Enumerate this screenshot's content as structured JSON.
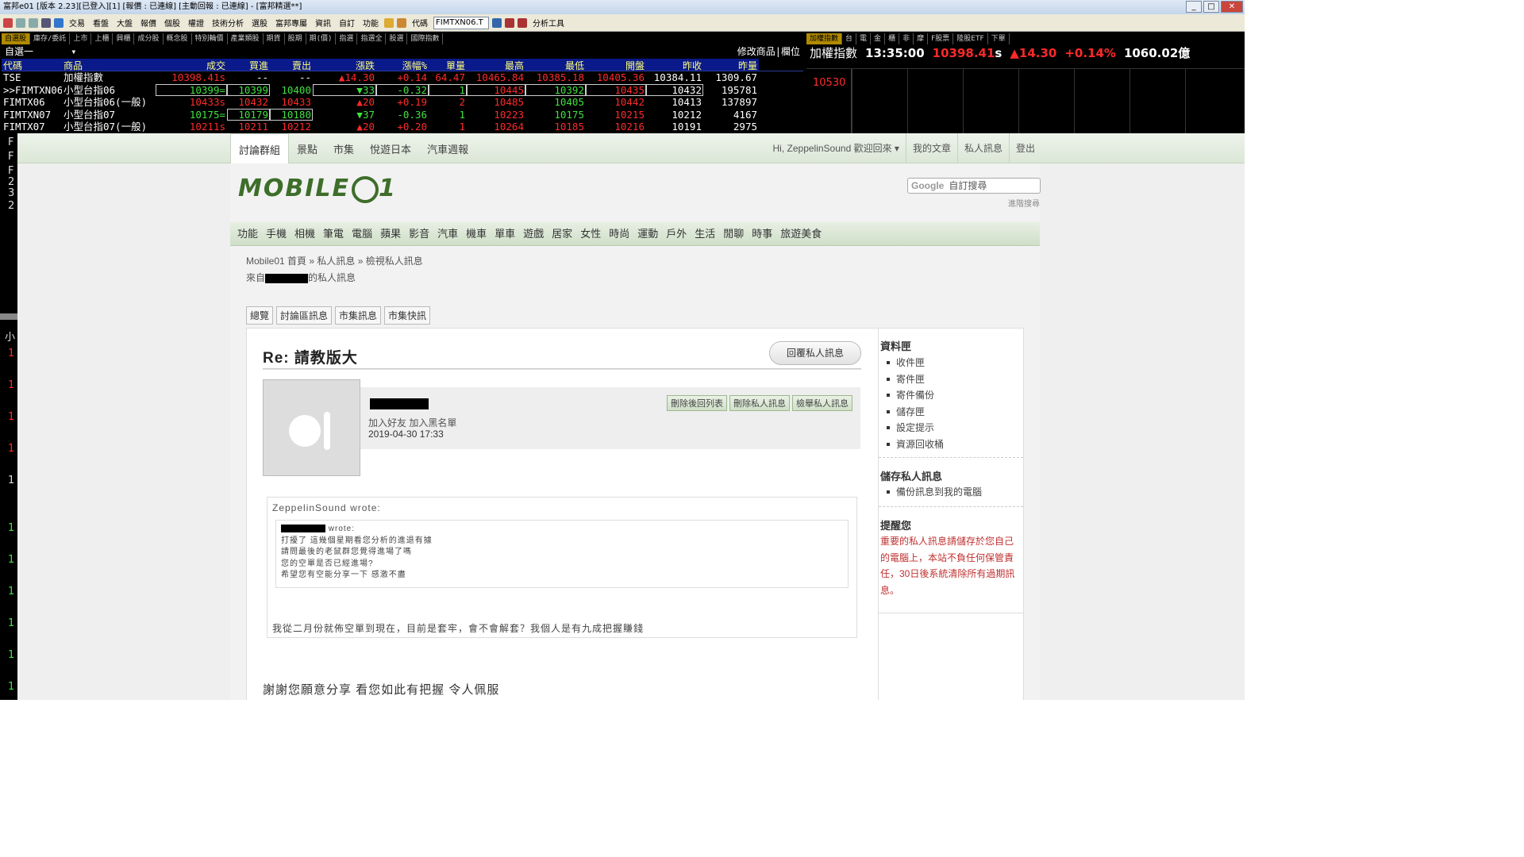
{
  "app": {
    "title": "富邦e01 [版本 2.23][已登入][1] [報價 : 已連線] [主動回報 : 已連線] - [富邦精選**]",
    "win_min": "_",
    "win_max": "□",
    "win_close": "✕",
    "toolbar": [
      "交易",
      "看盤",
      "大盤",
      "報價",
      "個股",
      "權證",
      "技術分析",
      "選股",
      "富邦專屬",
      "資訊",
      "自訂",
      "功能"
    ],
    "code_label": "代碼",
    "code_value": "FIMTXN06.T",
    "analysis_tools": "分析工具"
  },
  "quote": {
    "tabs": [
      "自選股",
      "庫存/委託",
      "上市",
      "上櫃",
      "興櫃",
      "成分股",
      "概念股",
      "特別輪價",
      "產業類股",
      "期貨",
      "股期",
      "期(價)",
      "指選",
      "指選全",
      "股選",
      "國際指數"
    ],
    "selector": "自選一",
    "selector_arrow": "▾",
    "right_links": [
      "修改商品",
      "欄位"
    ],
    "headers": [
      "代碼",
      "商品",
      "成交",
      "買進",
      "賣出",
      "漲跌",
      "漲幅%",
      "單量",
      "最高",
      "最低",
      "開盤",
      "昨收",
      "昨量"
    ],
    "rows": [
      [
        "TSE",
        "加權指數",
        "10398.41s",
        "--",
        "--",
        "▲14.30",
        "+0.14",
        "64.47",
        "10465.84",
        "10385.18",
        "10405.36",
        "10384.11",
        "1309.67"
      ],
      [
        ">>FIMTXN06",
        "小型台指06",
        "10399=",
        "10399",
        "10400",
        "▼33",
        "-0.32",
        "1",
        "10445",
        "10392",
        "10435",
        "10432",
        "195781"
      ],
      [
        "FIMTX06",
        "小型台指06(一般)",
        "10433s",
        "10432",
        "10433",
        "▲20",
        "+0.19",
        "2",
        "10485",
        "10405",
        "10442",
        "10413",
        "137897"
      ],
      [
        "FIMTXN07",
        "小型台指07",
        "10175=",
        "10179",
        "10180",
        "▼37",
        "-0.36",
        "1",
        "10223",
        "10175",
        "10215",
        "10212",
        "4167"
      ],
      [
        "FIMTX07",
        "小型台指07(一般)",
        "10211s",
        "10211",
        "10212",
        "▲20",
        "+0.20",
        "1",
        "10264",
        "10185",
        "10216",
        "10191",
        "2975"
      ]
    ]
  },
  "index": {
    "tabs": [
      "加權指數",
      "台",
      "電",
      "金",
      "櫃",
      "非",
      "摩",
      "F股票",
      "陸股ETF",
      "下單"
    ],
    "name": "加權指數",
    "time": "13:35:00",
    "price": "10398.41",
    "price_flag": "s",
    "change": "▲14.30",
    "pct": "+0.14%",
    "volume": "1060.02億",
    "chart_label": "10530"
  },
  "leftstrip": {
    "top": [
      "F",
      "F",
      "F",
      "2",
      "3",
      "2"
    ],
    "label": "小",
    "vals": [
      "1",
      "1",
      "1",
      "1",
      "1",
      "1",
      "1",
      "1",
      "1",
      "1",
      "1",
      "1"
    ]
  },
  "site": {
    "topnav": [
      "討論群組",
      "景點",
      "市集",
      "悅遊日本",
      "汽車週報"
    ],
    "user": {
      "greeting": "Hi, ZeppelinSound 歡迎回來 ▾",
      "links": [
        "我的文章",
        "私人訊息",
        "登出"
      ]
    },
    "logo": "MOBILE",
    "logo_suffix": "1",
    "search_google": "Google",
    "search_placeholder": "自訂搜尋",
    "adv_search": "進階搜尋",
    "categories": [
      "功能",
      "手機",
      "相機",
      "筆電",
      "電腦",
      "蘋果",
      "影音",
      "汽車",
      "機車",
      "單車",
      "遊戲",
      "居家",
      "女性",
      "時尚",
      "運動",
      "戶外",
      "生活",
      "閒聊",
      "時事",
      "旅遊美食"
    ],
    "breadcrumb": "Mobile01 首頁 » 私人訊息 » 檢視私人訊息",
    "from_prefix": "來自",
    "from_suffix": "的私人訊息",
    "msg_tabs": [
      "總覽",
      "討論區訊息",
      "市集訊息",
      "市集快訊"
    ],
    "message": {
      "title": "Re: 請教版大",
      "reply_button": "回覆私人訊息",
      "links": "加入好友  加入黑名單",
      "date": "2019-04-30 17:33",
      "actions": [
        "刪除後回列表",
        "刪除私人訊息",
        "檢舉私人訊息"
      ],
      "outer_wrote": "ZeppelinSound wrote:",
      "inner_wrote": "wrote:",
      "inner_lines": [
        "打擾了 這幾個星期看您分析的進退有據",
        "請問最後的老鼠群您覺得進場了嗎",
        "您的空單是否已經進場?",
        "希望您有空能分享一下 感激不盡"
      ],
      "reply": "我從二月份就佈空單到現在，目前是套牢，會不會解套？我個人是有九成把握賺錢",
      "reply2": "謝謝您願意分享 看您如此有把握 令人佩服"
    },
    "sidebar": {
      "box_title": "資料匣",
      "box_items": [
        "收件匣",
        "寄件匣",
        "寄件備份",
        "儲存匣",
        "設定提示",
        "資源回收桶"
      ],
      "save_title": "儲存私人訊息",
      "save_items": [
        "備份訊息到我的電腦"
      ],
      "remind_title": "提醒您",
      "remind_text": "重要的私人訊息請儲存於您自己的電腦上，本站不負任何保管責任，30日後系統清除所有過期訊息。"
    }
  }
}
